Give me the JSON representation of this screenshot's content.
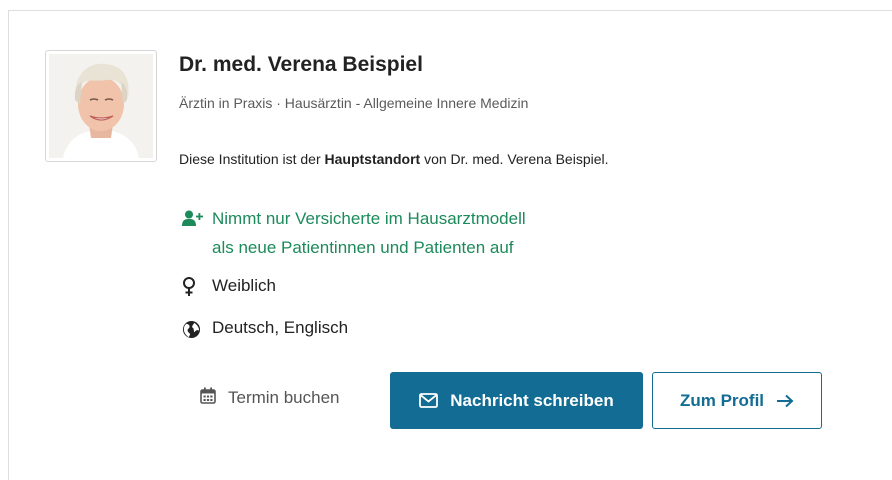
{
  "profile": {
    "name": "Dr. med. Verena Beispiel",
    "subtitle": "Ärztin in Praxis · Hausärztin - Allgemeine Innere Medizin",
    "institution_prefix": "Diese Institution ist der ",
    "institution_bold": "Hauptstandort",
    "institution_suffix": " von Dr. med. Verena Beispiel.",
    "acceptance_line1": "Nimmt nur Versicherte im Hausarztmodell",
    "acceptance_line2": "als neue Patientinnen und Patienten auf",
    "gender": "Weiblich",
    "languages": "Deutsch, Englisch"
  },
  "actions": {
    "termin_label": "Termin buchen",
    "message_label": "Nachricht schreiben",
    "profile_label": "Zum Profil"
  },
  "icons": {
    "acceptance": "user-plus-icon",
    "gender": "female-icon",
    "languages": "globe-icon",
    "termin": "calendar-icon",
    "message": "envelope-icon",
    "profile": "arrow-right-icon"
  },
  "colors": {
    "primary": "#126c93",
    "success": "#1c8a5a",
    "text": "#222222",
    "muted": "#5a5a5a"
  }
}
